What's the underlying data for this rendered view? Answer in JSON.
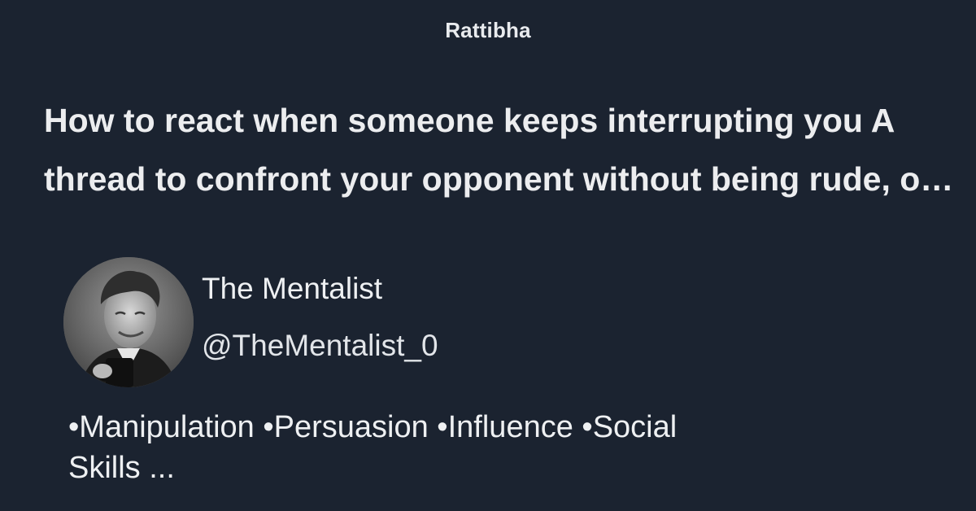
{
  "brand": "Rattibha",
  "thread": {
    "title": "How to react when someone keeps interrupting you A thread to confront your opponent without being rude, or having bad reactions"
  },
  "author": {
    "name": "The Mentalist",
    "handle": "@TheMentalist_0",
    "avatar_icon": "profile-photo"
  },
  "bio": {
    "line1": "•Manipulation •Persuasion •Influence •Social",
    "line2": "Skills ..."
  },
  "colors": {
    "background": "#1b2330",
    "text": "#eef0f2"
  }
}
